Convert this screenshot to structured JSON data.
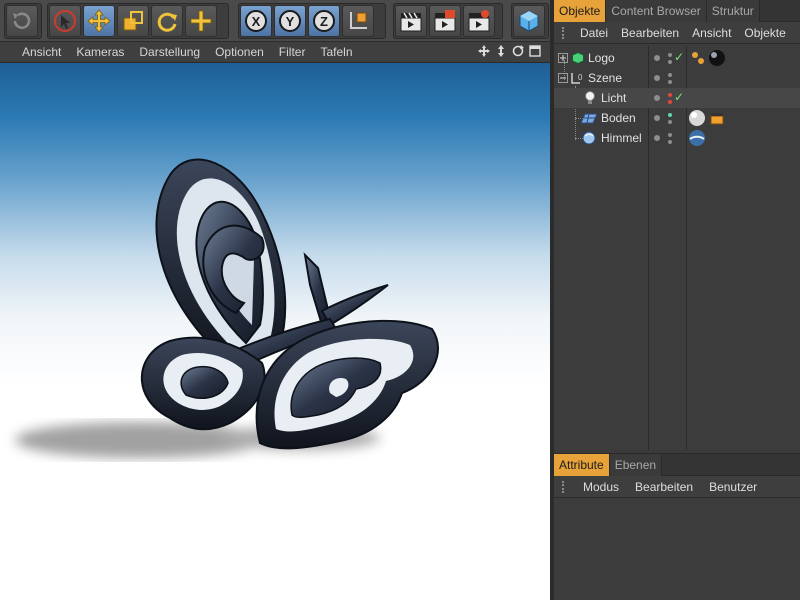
{
  "viewport_menu": [
    "Ansicht",
    "Kameras",
    "Darstellung",
    "Optionen",
    "Filter",
    "Tafeln"
  ],
  "object_manager": {
    "tabs": [
      "Objekte",
      "Content Browser",
      "Struktur"
    ],
    "menu": [
      "Datei",
      "Bearbeiten",
      "Ansicht",
      "Objekte"
    ],
    "objects": [
      {
        "name": "Logo"
      },
      {
        "name": "Szene"
      },
      {
        "name": "Licht"
      },
      {
        "name": "Boden"
      },
      {
        "name": "Himmel"
      }
    ]
  },
  "attribute_manager": {
    "tabs": [
      "Attribute",
      "Ebenen"
    ],
    "menu": [
      "Modus",
      "Bearbeiten",
      "Benutzer"
    ]
  },
  "toolbar": {
    "axis_buttons": [
      "X",
      "Y",
      "Z"
    ]
  },
  "colors": {
    "accent": "#e7a23a",
    "panel": "#3c3c3c",
    "check": "#7fe07f",
    "active_tool": "#5b84b8"
  }
}
